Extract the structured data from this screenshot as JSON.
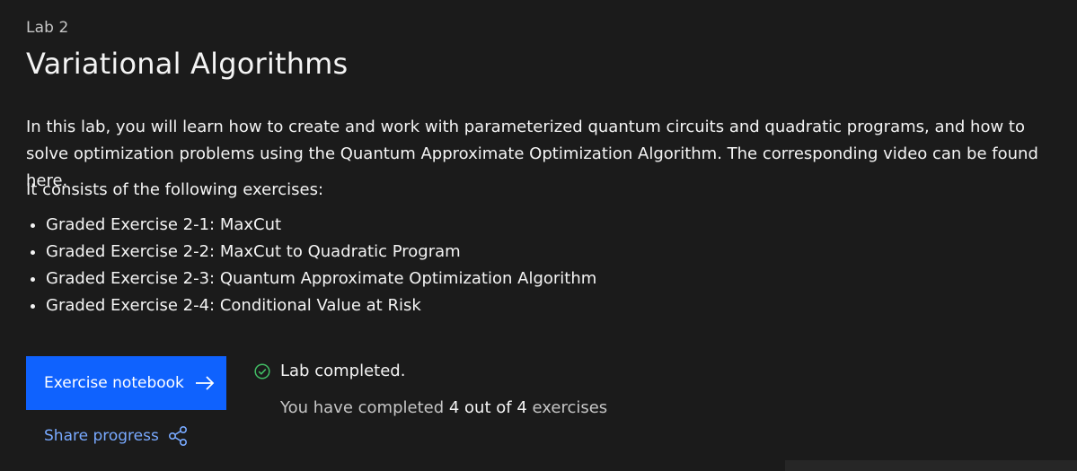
{
  "lab": {
    "eyebrow": "Lab 2",
    "title": "Variational Algorithms",
    "intro": "In this lab, you will learn how to create and work with parameterized quantum circuits and quadratic programs, and how to solve optimization problems using the Quantum Approximate Optimization Algorithm. The corresponding video can be found here.",
    "lead": "It consists of the following exercises:",
    "exercises": [
      "Graded Exercise 2-1: MaxCut",
      "Graded Exercise 2-2: MaxCut to Quadratic Program",
      "Graded Exercise 2-3: Quantum Approximate Optimization Algorithm",
      "Graded Exercise 2-4: Conditional Value at Risk"
    ]
  },
  "actions": {
    "notebook_label": "Exercise notebook",
    "notebook_icon": "arrow-right-icon",
    "share_label": "Share progress",
    "share_icon": "share-icon"
  },
  "status": {
    "icon": "checkmark-outline-icon",
    "label": "Lab completed.",
    "progress_prefix": "You have completed",
    "progress_count": "4 out of 4",
    "progress_suffix": "exercises"
  },
  "colors": {
    "background": "#1b1b1b",
    "primary_button": "#0f62fe",
    "link": "#78a9ff",
    "success": "#42be65"
  }
}
